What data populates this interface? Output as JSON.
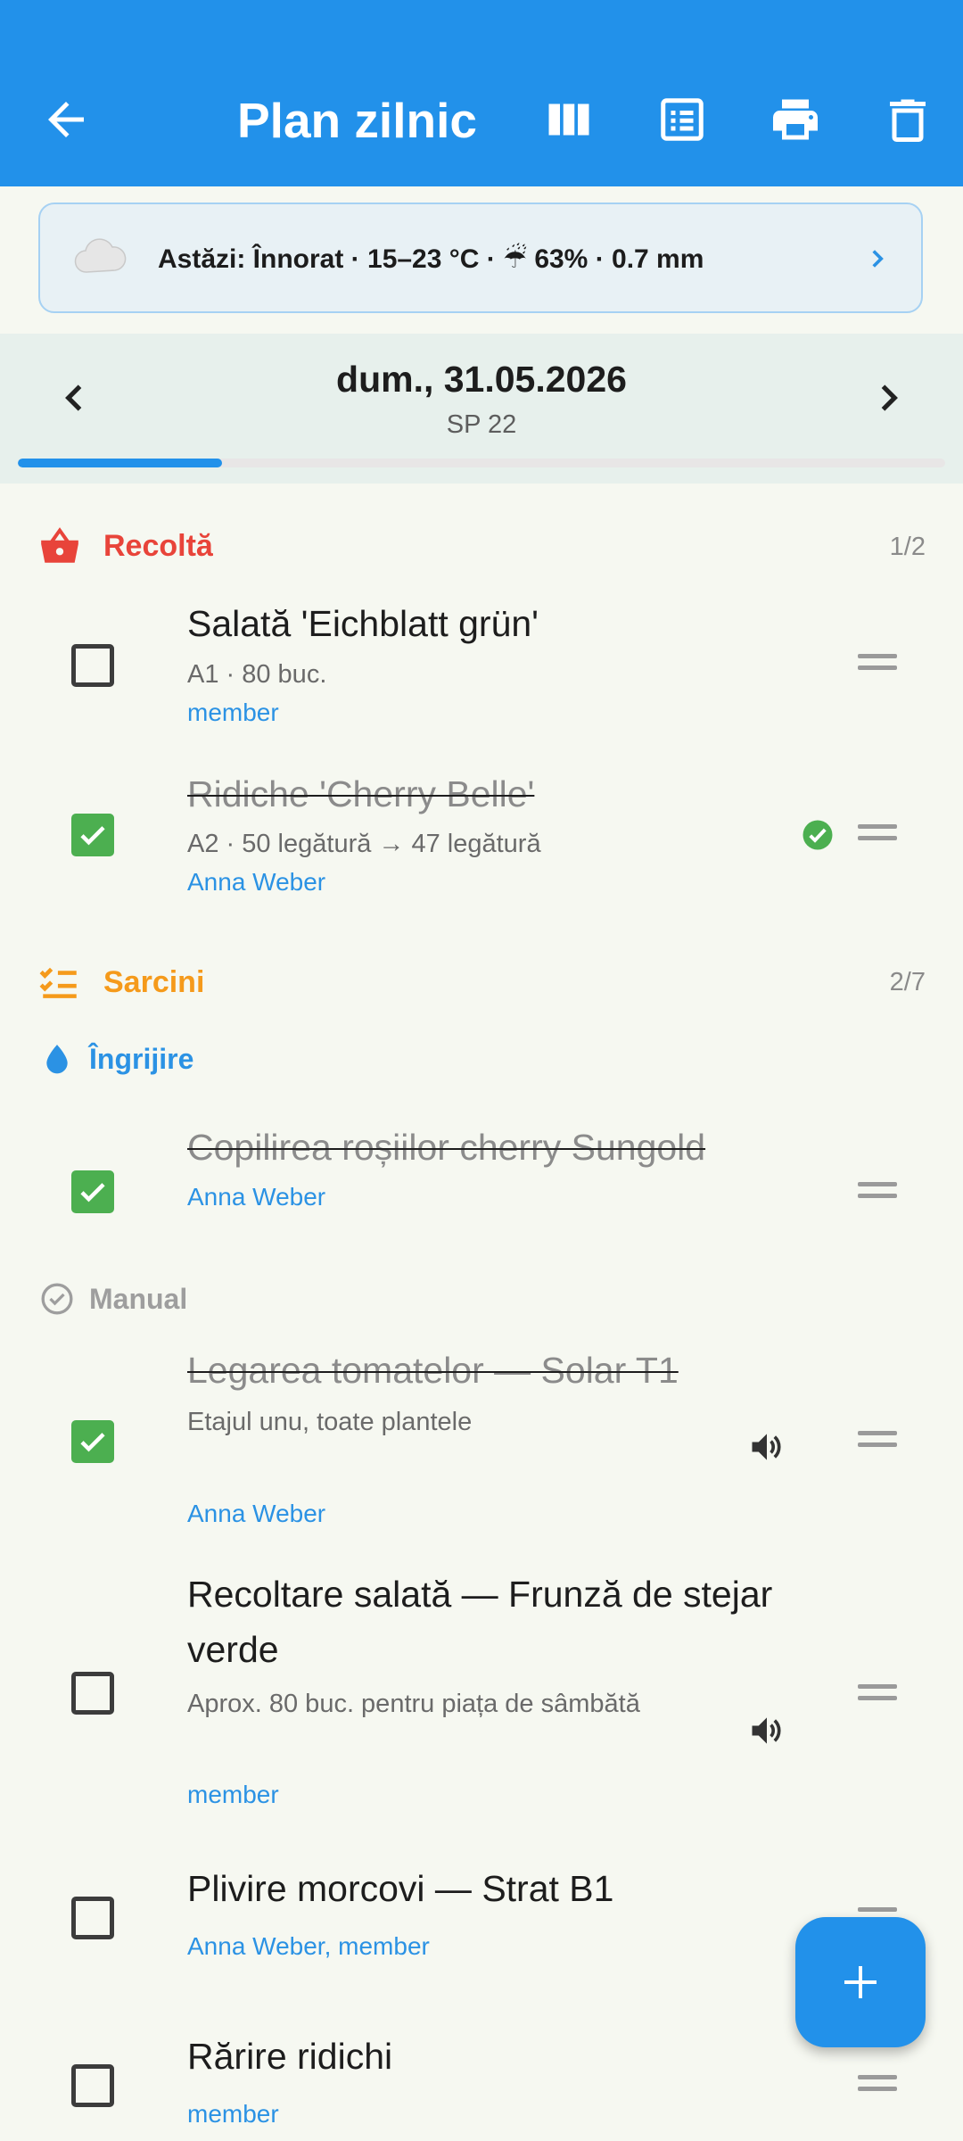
{
  "appbar": {
    "title": "Plan zilnic",
    "icons": [
      "back-arrow-icon",
      "columns-view-icon",
      "list-view-icon",
      "print-icon",
      "delete-icon"
    ]
  },
  "weather": {
    "icon": "cloud-icon",
    "text": "Astăzi: Înnorat · 15–23 °C · ☔ 63% · 0.7 mm"
  },
  "date_nav": {
    "date": "dum., 31.05.2026",
    "week": "SP 22",
    "progress": 0.22
  },
  "sections": {
    "harvest": {
      "label": "Recoltă",
      "count": "1/2",
      "color": "#e8443a",
      "items": [
        {
          "title": "Salată 'Eichblatt grün'",
          "subtitle": "A1 · 80 buc.",
          "assignee": "member",
          "done": false
        },
        {
          "title": "Ridiche 'Cherry Belle'",
          "subtitle": "A2 · 50 legătură → 47 legătură",
          "assignee": "Anna Weber",
          "done": true
        }
      ]
    },
    "tasks": {
      "label": "Sarcini",
      "count": "2/7",
      "color": "#f59a1b",
      "care": {
        "label": "Îngrijire",
        "color": "#2b92e4",
        "items": [
          {
            "title": "Copilirea roșiilor cherry Sungold",
            "assignee": "Anna Weber",
            "done": true
          }
        ]
      },
      "manual": {
        "label": "Manual",
        "color": "#9e9e9e",
        "items": [
          {
            "title": "Legarea tomatelor — Solar T1",
            "subtitle": "Etajul unu, toate plantele",
            "assignee": "Anna Weber",
            "done": true
          },
          {
            "title": "Recoltare salată — Frunză de stejar verde",
            "subtitle": "Aprox. 80 buc. pentru piața de sâmbătă",
            "assignee": "member",
            "done": false
          },
          {
            "title": "Plivire morcovi — Strat B1",
            "assignee": "Anna Weber, member",
            "done": false
          },
          {
            "title": "Rărire ridichi",
            "assignee": "member",
            "done": false
          }
        ]
      }
    }
  },
  "fab": {
    "icon": "plus-icon"
  }
}
